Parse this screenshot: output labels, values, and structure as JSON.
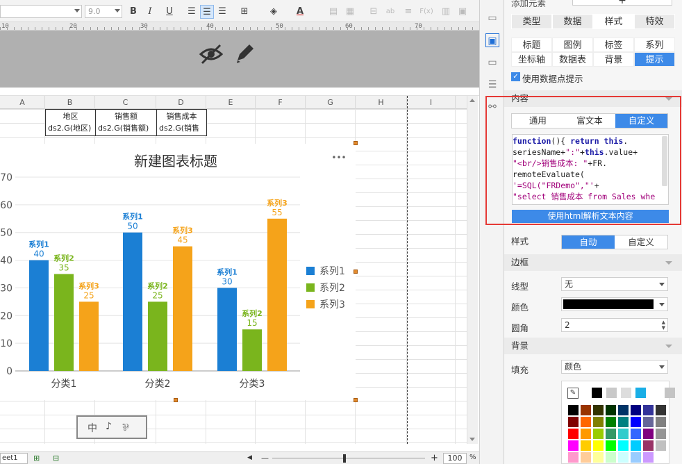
{
  "toolbar": {
    "font_size": "9.0",
    "bold": "B",
    "italic": "I",
    "underline": "U",
    "font_color_glyph": "A",
    "ab_glyph": "ab",
    "fx_glyph": "F(x)"
  },
  "ruler": {
    "ticks": [
      "10",
      "20",
      "30",
      "40",
      "50",
      "60",
      "70"
    ]
  },
  "columns": [
    "A",
    "B",
    "C",
    "D",
    "E",
    "F",
    "G",
    "H",
    "I"
  ],
  "cells": {
    "b1": "地区",
    "c1": "销售额",
    "d1": "销售成本",
    "b2": "ds2.G(地区)",
    "c2": "ds2.G(销售额)",
    "d2": "ds2.G(销售"
  },
  "chart_data": {
    "type": "bar",
    "title": "新建图表标题",
    "more_glyph": "•••",
    "categories": [
      "分类1",
      "分类2",
      "分类3"
    ],
    "series": [
      {
        "name": "系列1",
        "color": "#1b7fd4",
        "values": [
          40,
          50,
          30
        ]
      },
      {
        "name": "系列2",
        "color": "#7ab51d",
        "values": [
          35,
          25,
          15
        ]
      },
      {
        "name": "系列3",
        "color": "#f5a31a",
        "values": [
          25,
          45,
          55
        ]
      }
    ],
    "y_ticks": [
      "70",
      "60",
      "50",
      "40",
      "30",
      "20",
      "10",
      "0"
    ],
    "ylim": [
      0,
      70
    ],
    "legend_position": "right",
    "grid": true
  },
  "toolbox_glyphs": [
    "中",
    "♪",
    "⅌"
  ],
  "bottombar": {
    "sheet": "eet1",
    "zoom": "100",
    "zoom_unit": "%",
    "minus": "—",
    "plus": "+"
  },
  "panel": {
    "top_label": "添加元素",
    "top_plus": "+",
    "main_tabs": [
      "类型",
      "数据",
      "样式",
      "特效"
    ],
    "sub_tabs": [
      "标题",
      "图例",
      "标签",
      "系列",
      "坐标轴",
      "数据表",
      "背景",
      "提示"
    ],
    "use_datapoint_tip": "使用数据点提示",
    "content_section": "内容",
    "content_tabs": [
      "通用",
      "富文本",
      "自定义"
    ],
    "html_button": "使用html解析文本内容",
    "style_label": "样式",
    "style_options": [
      "自动",
      "自定义"
    ],
    "border_section": "边框",
    "line_type_label": "线型",
    "line_type_value": "无",
    "color_label": "颜色",
    "radius_label": "圆角",
    "radius_value": "2",
    "background_section": "背景",
    "fill_label": "填充",
    "fill_value": "颜色"
  },
  "code_lines": [
    [
      [
        "kw",
        "function"
      ],
      [
        "pl",
        "(){ "
      ],
      [
        "kw",
        "return this"
      ],
      [
        "pl",
        "."
      ]
    ],
    [
      [
        "pl",
        "seriesName+"
      ],
      [
        "st",
        "\":\""
      ],
      [
        "pl",
        "+"
      ],
      [
        "kw",
        "this"
      ],
      [
        "pl",
        ".value+"
      ]
    ],
    [
      [
        "st",
        "\"<br/>销售成本: \""
      ],
      [
        "pl",
        "+FR."
      ]
    ],
    [
      [
        "pl",
        "remoteEvaluate("
      ]
    ],
    [
      [
        "st",
        "'=SQL(\"FRDemo\",\"'"
      ],
      [
        "pl",
        "+"
      ]
    ],
    [
      [
        "st",
        "\"select 销售成本 from Sales whe"
      ]
    ]
  ],
  "colors": {
    "accent": "#3d8ae8",
    "highlight_box": "#e53935",
    "palette_top": [
      "#000000",
      "#c9c9c9",
      "#dddddd",
      "#19aee6",
      "#ffffff",
      "#c4c4c4"
    ],
    "palette": [
      [
        "#000000",
        "#993300",
        "#333300",
        "#003300",
        "#003366",
        "#000080",
        "#333399",
        "#333333"
      ],
      [
        "#800000",
        "#ff6600",
        "#808000",
        "#008000",
        "#008080",
        "#0000ff",
        "#666699",
        "#808080"
      ],
      [
        "#ff0000",
        "#ff9900",
        "#99cc00",
        "#339966",
        "#33cccc",
        "#3366ff",
        "#800080",
        "#969696"
      ],
      [
        "#ff00ff",
        "#ffcc00",
        "#ffff00",
        "#00ff00",
        "#00ffff",
        "#00ccff",
        "#993366",
        "#c0c0c0"
      ],
      [
        "#ff99cc",
        "#ffcc99",
        "#ffff99",
        "#ccffcc",
        "#ccffff",
        "#99ccff",
        "#cc99ff",
        "#ffffff"
      ]
    ]
  }
}
